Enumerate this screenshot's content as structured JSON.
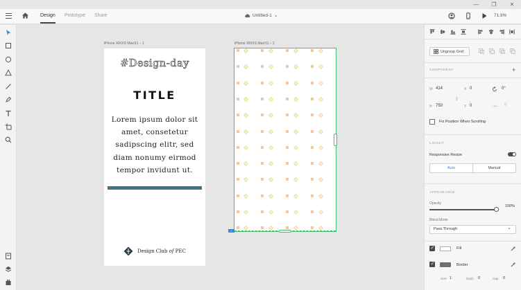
{
  "window_controls": [
    "—",
    "❐",
    "✕"
  ],
  "topbar": {
    "tabs": [
      {
        "label": "Design",
        "active": true
      },
      {
        "label": "Prototype",
        "active": false
      },
      {
        "label": "Share",
        "active": false
      }
    ],
    "document_title": "Untitled-1",
    "zoom": "71.9%"
  },
  "left_tools": [
    "select-icon",
    "rectangle-icon",
    "ellipse-icon",
    "polygon-icon",
    "line-icon",
    "pen-icon",
    "text-icon",
    "artboard-icon",
    "zoom-icon"
  ],
  "left_bottom_tools": [
    "document-assets-icon",
    "layers-icon",
    "plugins-icon"
  ],
  "canvas": {
    "artboard1": {
      "label": "iPhone XR/XS Max/11 – 1",
      "heading": "#Design-day",
      "title": "TITLE",
      "body": "Lorem ipsum dolor sit amet, consetetur sadipscing elitr, sed diam nonumy eirmod tempor invidunt ut.",
      "bar_color": "#3e7887",
      "club_prefix": "Design Club ",
      "club_of": "of",
      "club_suffix": " PEC"
    },
    "artboard2": {
      "label": "iPhone XR/XS Max/11 – 2",
      "tag": "↔",
      "selection_color": "#3ec16b"
    }
  },
  "right_panel": {
    "ungroup_label": "Ungroup Grid",
    "component_label": "COMPONENT",
    "w_label": "W",
    "w_value": "414",
    "h_label": "H",
    "h_value": "750",
    "x_label": "X",
    "x_value": "0",
    "y_label": "Y",
    "y_value": "0",
    "rotation_value": "0°",
    "fix_position_label": "Fix Position When Scrolling",
    "layout_label": "LAYOUT",
    "responsive_resize_label": "Responsive Resize",
    "responsive_resize_on": true,
    "auto_label": "Auto",
    "manual_label": "Manual",
    "appearance_label": "APPEARANCE",
    "opacity_label": "Opacity",
    "opacity_value": "100%",
    "blend_mode_label": "Blend Mode",
    "blend_mode_value": "Pass Through",
    "fill_label": "Fill",
    "fill_checked": true,
    "border_label": "Border",
    "border_checked": true,
    "border_color": "#707070",
    "size_label": "Size",
    "size_value": "1",
    "dash_label": "Dash",
    "dash_value": "0",
    "gap_label": "Gap",
    "gap_value": "0"
  }
}
